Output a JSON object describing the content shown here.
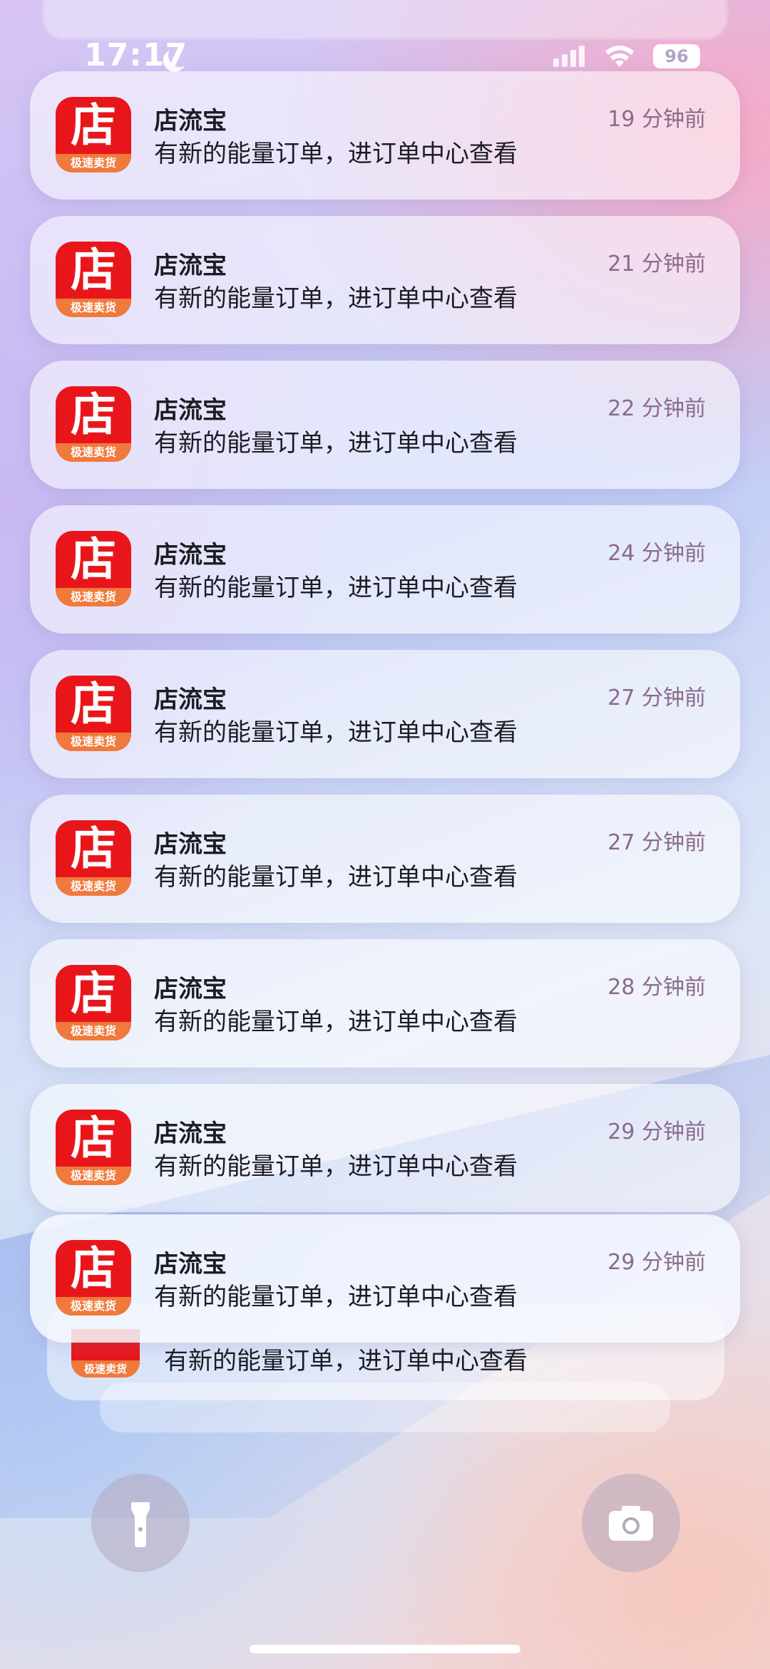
{
  "status_bar": {
    "time": "17:17",
    "battery": "96"
  },
  "notifications": [
    {
      "app": "店流宝",
      "message": "有新的能量订单，进订单中心查看",
      "time": "19 分钟前",
      "icon_text": "店",
      "icon_sub": "极速卖货"
    },
    {
      "app": "店流宝",
      "message": "有新的能量订单，进订单中心查看",
      "time": "21 分钟前",
      "icon_text": "店",
      "icon_sub": "极速卖货"
    },
    {
      "app": "店流宝",
      "message": "有新的能量订单，进订单中心查看",
      "time": "22 分钟前",
      "icon_text": "店",
      "icon_sub": "极速卖货"
    },
    {
      "app": "店流宝",
      "message": "有新的能量订单，进订单中心查看",
      "time": "24 分钟前",
      "icon_text": "店",
      "icon_sub": "极速卖货"
    },
    {
      "app": "店流宝",
      "message": "有新的能量订单，进订单中心查看",
      "time": "27 分钟前",
      "icon_text": "店",
      "icon_sub": "极速卖货"
    },
    {
      "app": "店流宝",
      "message": "有新的能量订单，进订单中心查看",
      "time": "27 分钟前",
      "icon_text": "店",
      "icon_sub": "极速卖货"
    },
    {
      "app": "店流宝",
      "message": "有新的能量订单，进订单中心查看",
      "time": "28 分钟前",
      "icon_text": "店",
      "icon_sub": "极速卖货"
    },
    {
      "app": "店流宝",
      "message": "有新的能量订单，进订单中心查看",
      "time": "29 分钟前",
      "icon_text": "店",
      "icon_sub": "极速卖货"
    },
    {
      "app": "店流宝",
      "message": "有新的能量订单，进订单中心查看",
      "time": "29 分钟前",
      "icon_text": "店",
      "icon_sub": "极速卖货"
    }
  ],
  "stacked": {
    "message": "有新的能量订单，进订单中心查看",
    "icon_sub": "极速卖货"
  },
  "icons": {
    "flashlight": "flashlight-icon",
    "camera": "camera-icon",
    "moon": "moon-icon",
    "signal": "signal-icon",
    "wifi": "wifi-icon"
  },
  "colors": {
    "app_red": "#e8161b",
    "app_orange": "#f07a3c"
  }
}
